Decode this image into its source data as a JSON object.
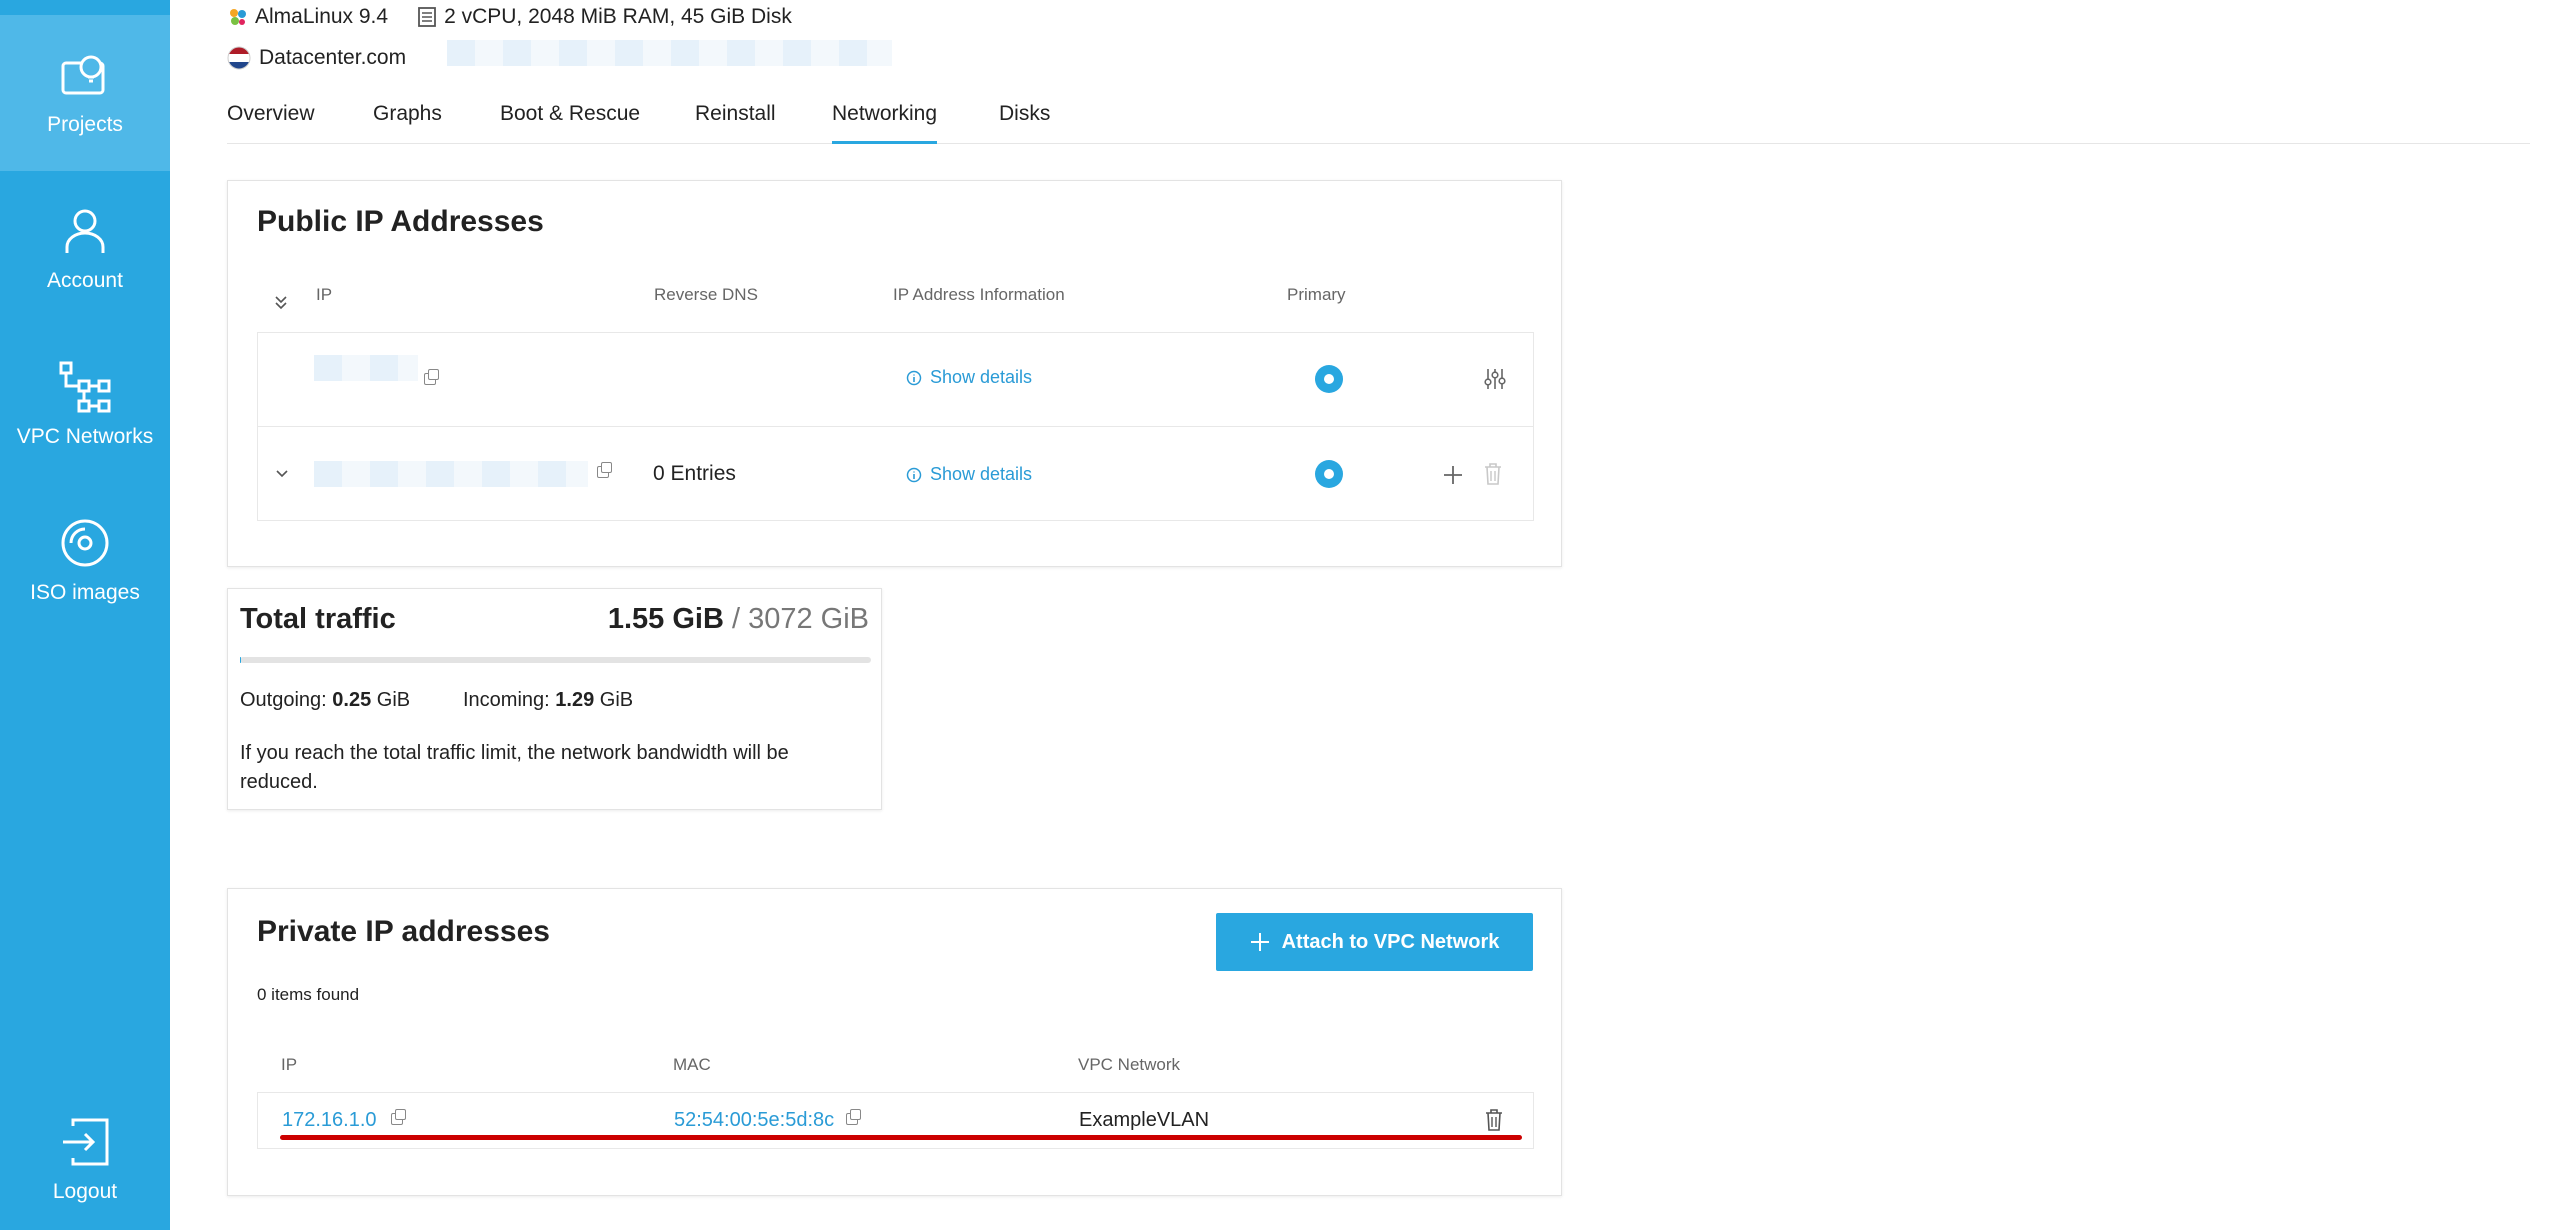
{
  "sidebar": {
    "items": [
      {
        "label": "Projects",
        "icon": "projects-icon"
      },
      {
        "label": "Account",
        "icon": "account-icon"
      },
      {
        "label": "VPC Networks",
        "icon": "vpc-networks-icon"
      },
      {
        "label": "ISO images",
        "icon": "iso-images-icon"
      }
    ],
    "logout": {
      "label": "Logout",
      "icon": "logout-icon"
    }
  },
  "header": {
    "os": "AlmaLinux 9.4",
    "specs": "2 vCPU, 2048 MiB RAM, 45 GiB Disk",
    "datacenter": "Datacenter.com"
  },
  "tabs": [
    "Overview",
    "Graphs",
    "Boot & Rescue",
    "Reinstall",
    "Networking",
    "Disks"
  ],
  "public_ip": {
    "title": "Public IP Addresses",
    "columns": {
      "ip": "IP",
      "reverse_dns": "Reverse DNS",
      "info": "IP Address Information",
      "primary": "Primary"
    },
    "rows": [
      {
        "reverse_dns": "",
        "info_link": "Show details",
        "primary": true
      },
      {
        "reverse_dns": "0 Entries",
        "info_link": "Show details",
        "primary": true
      }
    ]
  },
  "traffic": {
    "title": "Total traffic",
    "used": "1.55 GiB",
    "limit": "/ 3072 GiB",
    "usage_fraction": 0.0005,
    "outgoing_label": "Outgoing:",
    "outgoing_value": "0.25",
    "incoming_label": "Incoming:",
    "incoming_value": "1.29",
    "unit": "GiB",
    "note": "If you reach the total traffic limit, the network bandwidth will be reduced."
  },
  "private_ip": {
    "title": "Private IP addresses",
    "attach_button": "Attach to VPC Network",
    "items_found": "0 items found",
    "columns": {
      "ip": "IP",
      "mac": "MAC",
      "vpc": "VPC Network"
    },
    "rows": [
      {
        "ip": "172.16.1.0",
        "mac": "52:54:00:5e:5d:8c",
        "vpc": "ExampleVLAN"
      }
    ]
  },
  "colors": {
    "accent": "#29a7e0",
    "sidebar": "#29a7e0",
    "annotation": "#cc0000"
  }
}
